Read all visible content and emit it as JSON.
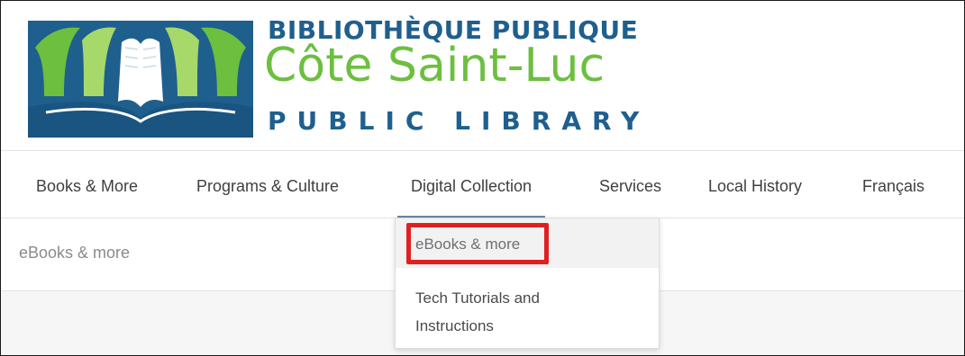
{
  "logo": {
    "line1": "BIBLIOTHÈQUE PUBLIQUE",
    "line2": "Côte Saint-Luc",
    "line3": "PUBLIC LIBRARY",
    "colors": {
      "blue": "#1f5f8e",
      "green": "#6cbf3f",
      "light_green": "#a6d86a"
    }
  },
  "nav": {
    "items": [
      {
        "label": "Books & More"
      },
      {
        "label": "Programs & Culture"
      },
      {
        "label": "Digital Collection"
      },
      {
        "label": "Services"
      },
      {
        "label": "Local History"
      },
      {
        "label": "Français"
      }
    ],
    "active_index": 2
  },
  "subbar": {
    "text": "eBooks & more"
  },
  "dropdown": {
    "items": [
      {
        "label": "eBooks & more"
      },
      {
        "label": "Tech Tutorials and Instructions"
      }
    ]
  },
  "annotation": {
    "highlight_color": "#e02020"
  }
}
